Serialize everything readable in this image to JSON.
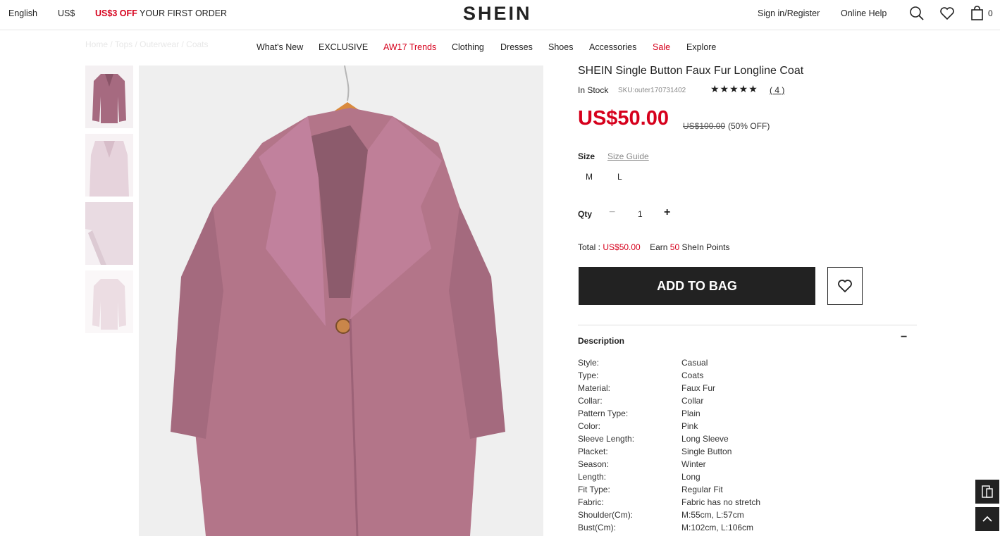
{
  "topbar": {
    "language": "English",
    "currency": "US$",
    "promo_highlight": "US$3 OFF",
    "promo_rest": "YOUR FIRST ORDER",
    "logo": "SHEIN",
    "signin": "Sign in/Register",
    "help": "Online Help",
    "bag_count": "0"
  },
  "nav": [
    "What's New",
    "EXCLUSIVE",
    "AW17 Trends",
    "Clothing",
    "Dresses",
    "Shoes",
    "Accessories",
    "Sale",
    "Explore"
  ],
  "product": {
    "title": "SHEIN Single Button Faux Fur Longline Coat",
    "stock": "In Stock",
    "sku": "SKU:outer170731402",
    "stars": "★★★★★",
    "reviews": "( 4 )",
    "price": "US$50.00",
    "old_price": "US$100.00",
    "discount": "(50% OFF)",
    "size_label": "Size",
    "size_guide": "Size Guide",
    "sizes": [
      "M",
      "L"
    ],
    "qty_label": "Qty",
    "qty_minus": "−",
    "qty_value": "1",
    "qty_plus": "+",
    "total_label": "Total : ",
    "total_value": "US$50.00",
    "earn_prefix": "Earn ",
    "earn_points": "50",
    "earn_suffix": " SheIn Points",
    "add_to_bag": "ADD TO BAG",
    "description_title": "Description",
    "description_toggle": "−",
    "specs": [
      {
        "k": "Style:",
        "v": "Casual"
      },
      {
        "k": "Type:",
        "v": "Coats"
      },
      {
        "k": "Material:",
        "v": "Faux Fur"
      },
      {
        "k": "Collar:",
        "v": "Collar"
      },
      {
        "k": "Pattern Type:",
        "v": "Plain"
      },
      {
        "k": "Color:",
        "v": "Pink"
      },
      {
        "k": "Sleeve Length:",
        "v": "Long Sleeve"
      },
      {
        "k": "Placket:",
        "v": "Single Button"
      },
      {
        "k": "Season:",
        "v": "Winter"
      },
      {
        "k": "Length:",
        "v": "Long"
      },
      {
        "k": "Fit Type:",
        "v": "Regular Fit"
      },
      {
        "k": "Fabric:",
        "v": "Fabric has no stretch"
      },
      {
        "k": "Shoulder(Cm):",
        "v": "M:55cm, L:57cm"
      },
      {
        "k": "Bust(Cm):",
        "v": "M:102cm, L:106cm"
      }
    ]
  },
  "colors": {
    "accent_red": "#d6001c",
    "dark": "#222222",
    "coat_pink": "#b77a8e"
  }
}
